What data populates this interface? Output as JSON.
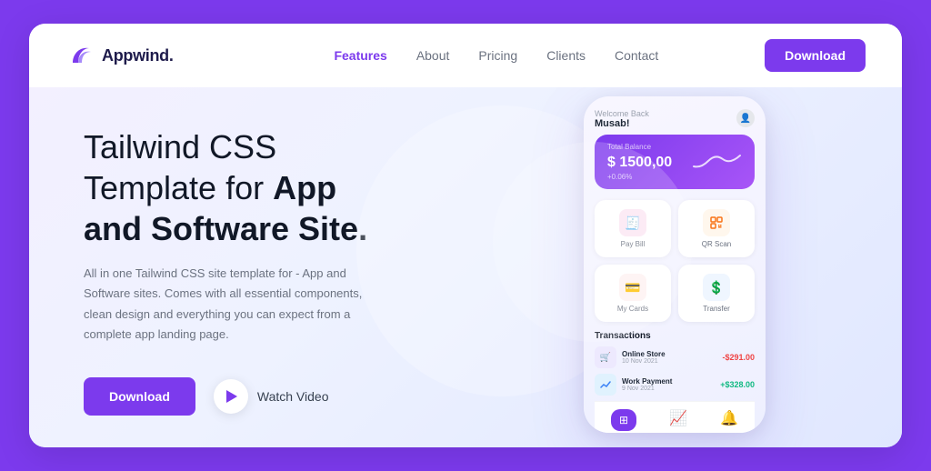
{
  "brand": {
    "name": "Appwind."
  },
  "nav": {
    "items": [
      {
        "label": "Features",
        "active": true
      },
      {
        "label": "About",
        "active": false
      },
      {
        "label": "Pricing",
        "active": false
      },
      {
        "label": "Clients",
        "active": false
      },
      {
        "label": "Contact",
        "active": false
      }
    ],
    "download_label": "Download"
  },
  "hero": {
    "title_line1": "Tailwind CSS",
    "title_line2": "Template for ",
    "title_bold": "App",
    "title_line3": "and Software Site.",
    "description": "All in one Tailwind CSS site template for - App and Software sites. Comes with all essential components, clean design and everything you can expect from a complete app landing page.",
    "download_label": "Download",
    "watch_label": "Watch Video"
  },
  "phone": {
    "welcome": "Welcome Back",
    "username": "Musab!",
    "balance_label": "Total Balance",
    "balance_amount": "$ 1500,00",
    "balance_change": "+0.06%",
    "actions": [
      {
        "label": "Pay Bill",
        "icon": "🧾",
        "color": "icon-pink"
      },
      {
        "label": "QR Scan",
        "icon": "⬛",
        "color": "icon-orange"
      },
      {
        "label": "My Cards",
        "icon": "💳",
        "color": "icon-red"
      },
      {
        "label": "Transfer",
        "icon": "💲",
        "color": "icon-blue"
      }
    ],
    "transactions_title": "Transactions",
    "transactions": [
      {
        "name": "Online Store",
        "sub": "10 Nov 2021",
        "amount": "-$291.00",
        "type": "negative"
      },
      {
        "name": "Work Payment",
        "sub": "9 Nov 2021",
        "amount": "+$328.00",
        "type": "positive"
      }
    ]
  },
  "colors": {
    "primary": "#7c3aed",
    "bg_outer": "#7c3aed"
  }
}
